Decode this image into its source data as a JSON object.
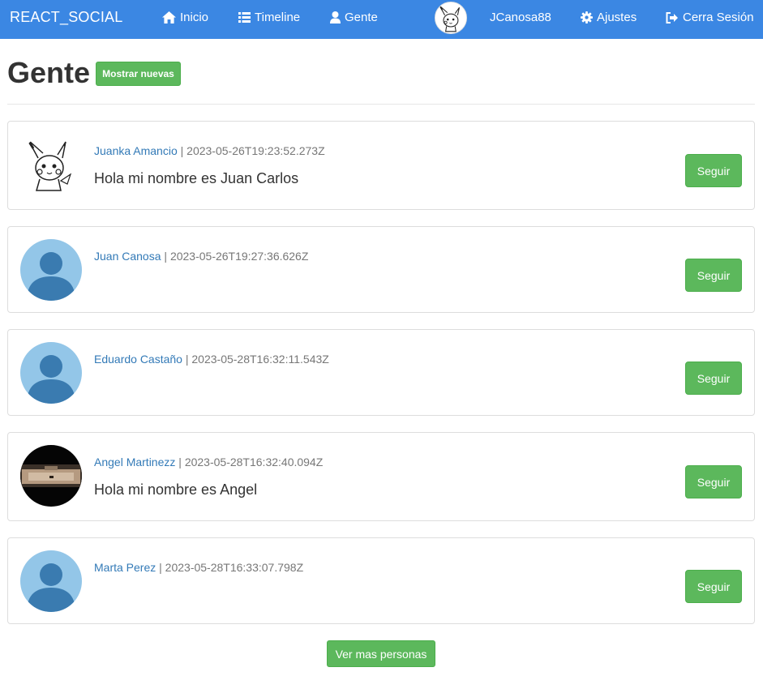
{
  "navbar": {
    "brand": "REACT_SOCIAL",
    "links": [
      {
        "label": "Inicio",
        "icon": "home-icon"
      },
      {
        "label": "Timeline",
        "icon": "list-icon"
      },
      {
        "label": "Gente",
        "icon": "user-icon"
      }
    ],
    "username": "JCanosa88",
    "settings_label": "Ajustes",
    "logout_label": "Cerra Sesión",
    "color": "#3b87e3"
  },
  "page": {
    "title": "Gente",
    "show_new_label": "Mostrar nuevas",
    "more_label": "Ver mas personas"
  },
  "people": [
    {
      "name": "Juanka Amancio",
      "date": "2023-05-26T19:23:52.273Z",
      "bio": "Hola mi nombre es Juan Carlos",
      "avatar": "pikachu-sketch",
      "follow_label": "Seguir"
    },
    {
      "name": "Juan Canosa",
      "date": "2023-05-26T19:27:36.626Z",
      "bio": "",
      "avatar": "default-silhouette",
      "follow_label": "Seguir"
    },
    {
      "name": "Eduardo Castaño",
      "date": "2023-05-28T16:32:11.543Z",
      "bio": "",
      "avatar": "default-silhouette",
      "follow_label": "Seguir"
    },
    {
      "name": "Angel Martinezz",
      "date": "2023-05-28T16:32:40.094Z",
      "bio": "Hola mi nombre es Angel",
      "avatar": "photo",
      "follow_label": "Seguir"
    },
    {
      "name": "Marta Perez",
      "date": "2023-05-28T16:33:07.798Z",
      "bio": "",
      "avatar": "default-silhouette",
      "follow_label": "Seguir"
    }
  ],
  "colors": {
    "button_green": "#5cb85c",
    "link_blue": "#337ab7",
    "avatar_bg": "#93c6e8",
    "avatar_fg": "#3a7bb0"
  }
}
